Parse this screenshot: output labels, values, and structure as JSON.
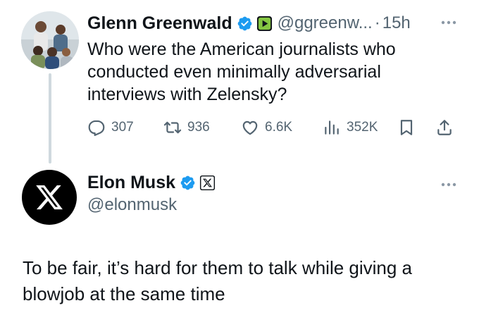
{
  "parent_tweet": {
    "author_name": "Glenn Greenwald",
    "handle": "@ggreenw...",
    "separator": "·",
    "time": "15h",
    "text": "Who were the American journalists who conducted even minimally adversarial interviews with Zelensky?",
    "stats": {
      "replies": "307",
      "reposts": "936",
      "likes": "6.6K",
      "views": "352K"
    },
    "icons": [
      "verified-badge-icon",
      "rumble-badge-icon",
      "more-icon",
      "reply-icon",
      "repost-icon",
      "like-icon",
      "views-icon",
      "bookmark-icon",
      "share-icon"
    ]
  },
  "main_tweet": {
    "author_name": "Elon Musk",
    "handle": "@elonmusk",
    "text": "To be fair, it’s hard for them to talk while giving a blowjob at the same time",
    "icons": [
      "x-logo-avatar",
      "verified-badge-icon",
      "x-affiliation-badge-icon",
      "more-icon"
    ]
  },
  "colors": {
    "text_primary": "#0f1419",
    "text_secondary": "#536471",
    "verified_blue": "#1d9bf0",
    "thread_line": "#cfd9de",
    "rumble_green": "#85c742"
  }
}
